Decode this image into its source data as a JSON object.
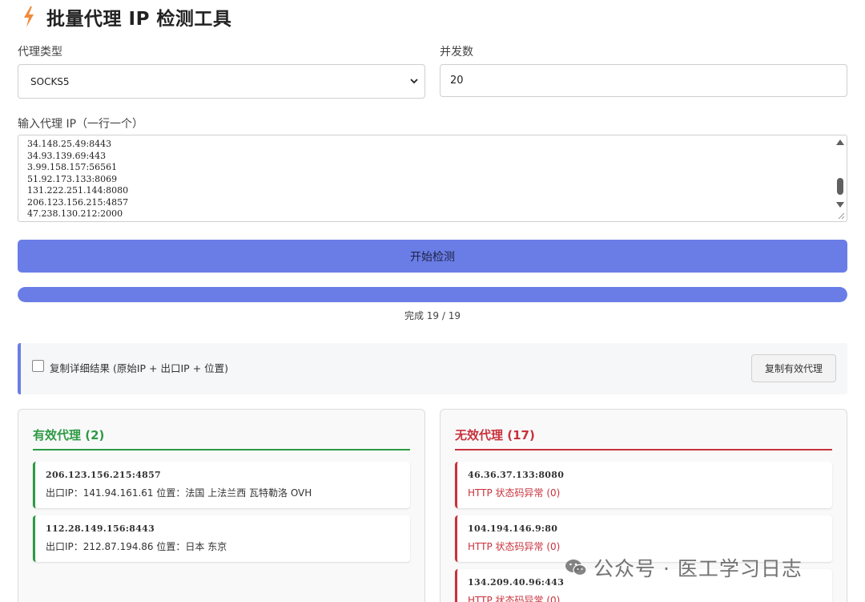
{
  "header": {
    "title": "批量代理 IP 检测工具",
    "icon": "lightning-bolt-icon"
  },
  "form": {
    "proxy_type_label": "代理类型",
    "proxy_type_value": "SOCKS5",
    "concurrency_label": "并发数",
    "concurrency_value": "20",
    "input_label": "输入代理 IP（一行一个）",
    "input_lines": [
      "34.148.25.49:8443",
      "34.93.139.69:443",
      "3.99.158.157:56561",
      "51.92.173.133:8069",
      "131.222.251.144:8080",
      "206.123.156.215:4857",
      "47.238.130.212:2000"
    ]
  },
  "actions": {
    "start_label": "开始检测"
  },
  "progress": {
    "fraction": 1.0,
    "text": "完成 19 / 19"
  },
  "options": {
    "copy_detail_label": "复制详细结果 (原始IP + 出口IP + 位置)",
    "copy_detail_checked": false,
    "copy_button_label": "复制有效代理"
  },
  "valid": {
    "title": "有效代理 (2)",
    "items": [
      {
        "ip": "206.123.156.215:4857",
        "detail": "出口IP：141.94.161.61 位置：法国 上法兰西 瓦特勒洛 OVH"
      },
      {
        "ip": "112.28.149.156:8443",
        "detail": "出口IP：212.87.194.86 位置：日本 东京"
      }
    ]
  },
  "invalid": {
    "title": "无效代理 (17)",
    "items": [
      {
        "ip": "46.36.37.133:8080",
        "detail": "HTTP 状态码异常 (0)"
      },
      {
        "ip": "104.194.146.9:80",
        "detail": "HTTP 状态码异常 (0)"
      },
      {
        "ip": "134.209.40.96:443",
        "detail": "HTTP 状态码异常 (0)"
      }
    ]
  },
  "watermark": {
    "text": "公众号 · 医工学习日志",
    "icon": "wechat-icon"
  },
  "colors": {
    "accent": "#6a7de6",
    "valid": "#2d9a43",
    "invalid": "#c8323c"
  }
}
